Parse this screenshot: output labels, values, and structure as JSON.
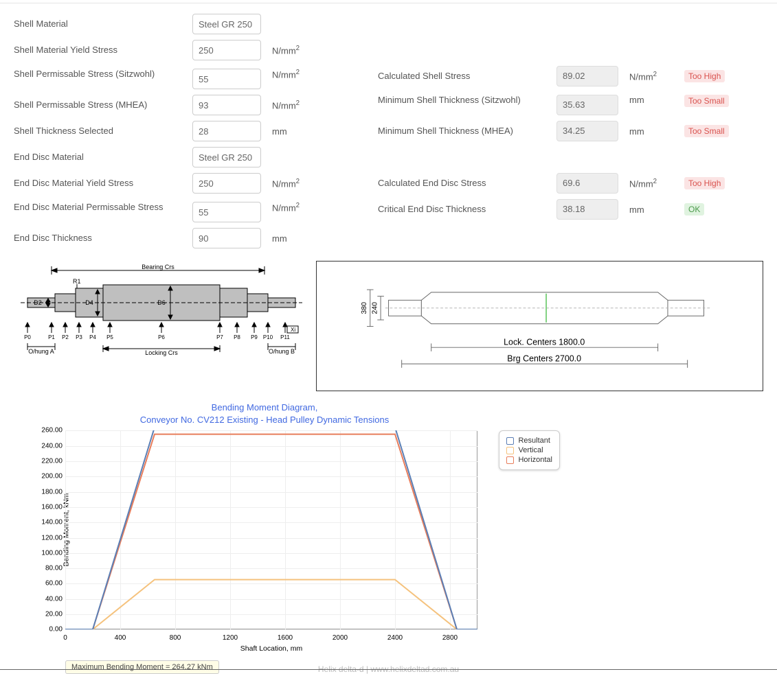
{
  "fields": {
    "shell_material": {
      "label": "Shell Material",
      "value": "Steel GR 250"
    },
    "shell_yield": {
      "label": "Shell Material Yield Stress",
      "value": "250",
      "unit": "N/mm²"
    },
    "shell_perm_sitz": {
      "label": "Shell Permissable Stress (Sitzwohl)",
      "value": "55",
      "unit": "N/mm²"
    },
    "shell_perm_mhea": {
      "label": "Shell Permissable Stress (MHEA)",
      "value": "93",
      "unit": "N/mm²"
    },
    "shell_thick": {
      "label": "Shell Thickness Selected",
      "value": "28",
      "unit": "mm"
    },
    "end_material": {
      "label": "End Disc Material",
      "value": "Steel GR 250"
    },
    "end_yield": {
      "label": "End Disc Material Yield Stress",
      "value": "250",
      "unit": "N/mm²"
    },
    "end_perm": {
      "label": "End Disc Material Permissable Stress",
      "value": "55",
      "unit": "N/mm²"
    },
    "end_thick": {
      "label": "End Disc Thickness",
      "value": "90",
      "unit": "mm"
    }
  },
  "results": {
    "calc_shell": {
      "label": "Calculated Shell Stress",
      "value": "89.02",
      "unit": "N/mm²",
      "status": "Too High",
      "status_class": "bad"
    },
    "min_shell_sitz": {
      "label": "Minimum Shell Thickness (Sitzwohl)",
      "value": "35.63",
      "unit": "mm",
      "status": "Too Small",
      "status_class": "bad"
    },
    "min_shell_mhea": {
      "label": "Minimum Shell Thickness (MHEA)",
      "value": "34.25",
      "unit": "mm",
      "status": "Too Small",
      "status_class": "bad"
    },
    "calc_end": {
      "label": "Calculated End Disc Stress",
      "value": "69.6",
      "unit": "N/mm²",
      "status": "Too High",
      "status_class": "bad"
    },
    "crit_end": {
      "label": "Critical End Disc Thickness",
      "value": "38.18",
      "unit": "mm",
      "status": "OK",
      "status_class": "ok"
    }
  },
  "shaft_diagram": {
    "bearing_crs": "Bearing Crs",
    "locking_crs": "Locking Crs",
    "r1": "R1",
    "d2": "D2",
    "d4": "D4",
    "d6": "D6",
    "p_labels": [
      "P0",
      "P1",
      "P2",
      "P3",
      "P4",
      "P5",
      "P6",
      "P7",
      "P8",
      "P9",
      "P10",
      "P11"
    ],
    "ohung_a": "O/hung A",
    "ohung_b": "O/hung B",
    "xi": "Xi"
  },
  "right_diagram": {
    "dim1": "380",
    "dim2": "240",
    "lock_centers": "Lock. Centers 1800.0",
    "brg_centers": "Brg Centers 2700.0"
  },
  "chart": {
    "title1": "Bending Moment Diagram,",
    "title2": "Conveyor No. CV212 Existing - Head Pulley Dynamic Tensions",
    "ylabel": "Bending Moment, kNm",
    "xlabel": "Shaft Location, mm",
    "legend": {
      "resultant": "Resultant",
      "vertical": "Vertical",
      "horizontal": "Horizontal"
    },
    "colors": {
      "resultant": "#5b7fb5",
      "vertical": "#f5c27d",
      "horizontal": "#e87d5b"
    },
    "max_moment": "Maximum Bending Moment = 264.27 kNm"
  },
  "chart_data": {
    "type": "line",
    "xlabel": "Shaft Location, mm",
    "ylabel": "Bending Moment, kNm",
    "xlim": [
      0,
      3000
    ],
    "ylim": [
      0,
      260
    ],
    "x": [
      0,
      200,
      650,
      2400,
      2850,
      3000
    ],
    "series": [
      {
        "name": "Resultant",
        "values": [
          0,
          0,
          264,
          264,
          0,
          0
        ]
      },
      {
        "name": "Vertical",
        "values": [
          0,
          0,
          65,
          65,
          0,
          0
        ]
      },
      {
        "name": "Horizontal",
        "values": [
          0,
          0,
          255,
          255,
          0,
          0
        ]
      }
    ],
    "y_ticks": [
      0,
      20,
      40,
      60,
      80,
      100,
      120,
      140,
      160,
      180,
      200,
      220,
      240,
      260
    ],
    "x_ticks": [
      0,
      400,
      800,
      1200,
      1600,
      2000,
      2400,
      2800
    ]
  },
  "footer": "Helix delta-d   |   www.helixdeltad.com.au"
}
